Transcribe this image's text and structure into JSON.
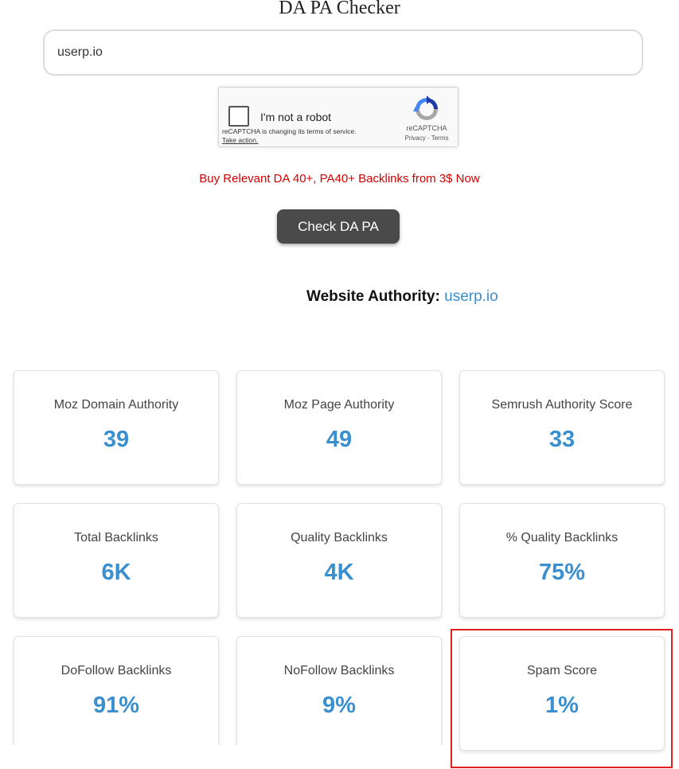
{
  "page": {
    "title": "DA PA Checker"
  },
  "form": {
    "url_value": "userp.io",
    "recaptcha": {
      "label": "I'm not a robot",
      "notice": "reCAPTCHA is changing its terms of service.",
      "take_action": "Take action.",
      "brand": "reCAPTCHA",
      "privacy": "Privacy",
      "separator": " - ",
      "terms": "Terms"
    },
    "promo_text": "Buy Relevant DA 40+, PA40+ Backlinks from 3$ Now",
    "submit_label": "Check DA PA"
  },
  "result": {
    "heading_label": "Website Authority:",
    "domain": "userp.io",
    "metrics": [
      {
        "label": "Moz Domain Authority",
        "value": "39"
      },
      {
        "label": "Moz Page Authority",
        "value": "49"
      },
      {
        "label": "Semrush Authority Score",
        "value": "33"
      },
      {
        "label": "Total Backlinks",
        "value": "6K"
      },
      {
        "label": "Quality Backlinks",
        "value": "4K"
      },
      {
        "label": "% Quality Backlinks",
        "value": "75%"
      },
      {
        "label": "DoFollow Backlinks",
        "value": "91%"
      },
      {
        "label": "NoFollow Backlinks",
        "value": "9%"
      },
      {
        "label": "Spam Score",
        "value": "1%"
      }
    ]
  },
  "colors": {
    "accent": "#3a8fd0",
    "promo": "#d40000",
    "button": "#4a4a4a",
    "highlight": "#e02020"
  },
  "icons": {
    "recaptcha": "recaptcha-logo-icon"
  }
}
